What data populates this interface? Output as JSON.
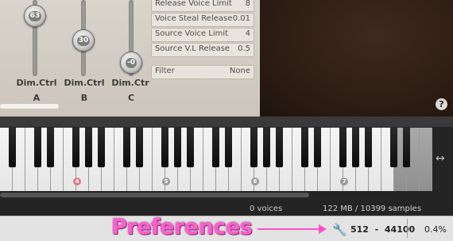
{
  "sliders": [
    {
      "knob_value": "63",
      "label": "Dim.Ctrl",
      "letter": "A"
    },
    {
      "knob_value": "30",
      "label": "Dim.Ctrl",
      "letter": "B"
    },
    {
      "knob_value": "-0",
      "label": "Dim.Ctr",
      "letter": "C"
    }
  ],
  "params": [
    {
      "label": "Release Voice Limit",
      "value": "8"
    },
    {
      "label": "Voice Steal Release",
      "value": "0.01"
    },
    {
      "label": "Source Voice Limit",
      "value": "4"
    },
    {
      "label": "Source V.L Release",
      "value": "0.5"
    }
  ],
  "filter": {
    "label": "Filter",
    "value": "None"
  },
  "help_icon": "?",
  "octave_markers": [
    "4",
    "5",
    "6",
    "7"
  ],
  "keyboard_info": {
    "voices": "0 voices",
    "memory": "122 MB / 10399 samples"
  },
  "status": {
    "preferences": "Preferences",
    "buffer": "512",
    "dash": "-",
    "sample_rate": "44100",
    "cpu": "0.4%"
  },
  "colors": {
    "accent_pink": "#ff5fd0",
    "panel": "#d3cec5"
  }
}
